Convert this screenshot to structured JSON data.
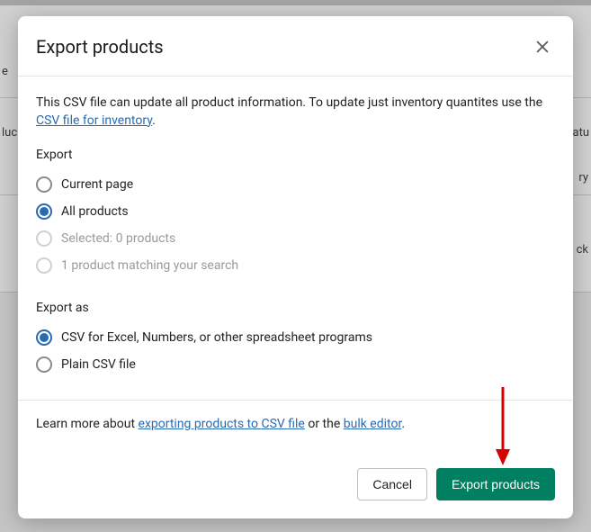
{
  "bg": {
    "col1_frag": "e",
    "col2_frag": "luc",
    "status_frag": "atu",
    "inventory_frag": "ry",
    "stock_frag": "ck"
  },
  "modal": {
    "title": "Export products",
    "description_prefix": "This CSV file can update all product information. To update just inventory quantites use the ",
    "description_link": "CSV file for inventory",
    "description_suffix": ".",
    "export_label": "Export",
    "options": {
      "current_page": "Current page",
      "all_products": "All products",
      "selected": "Selected: 0 products",
      "matching": "1 product matching your search"
    },
    "export_as_label": "Export as",
    "format_options": {
      "csv_excel": "CSV for Excel, Numbers, or other spreadsheet programs",
      "plain_csv": "Plain CSV file"
    },
    "help_prefix": "Learn more about ",
    "help_link1": "exporting products to CSV file",
    "help_mid": " or the ",
    "help_link2": "bulk editor",
    "help_suffix": ".",
    "cancel": "Cancel",
    "submit": "Export products"
  }
}
